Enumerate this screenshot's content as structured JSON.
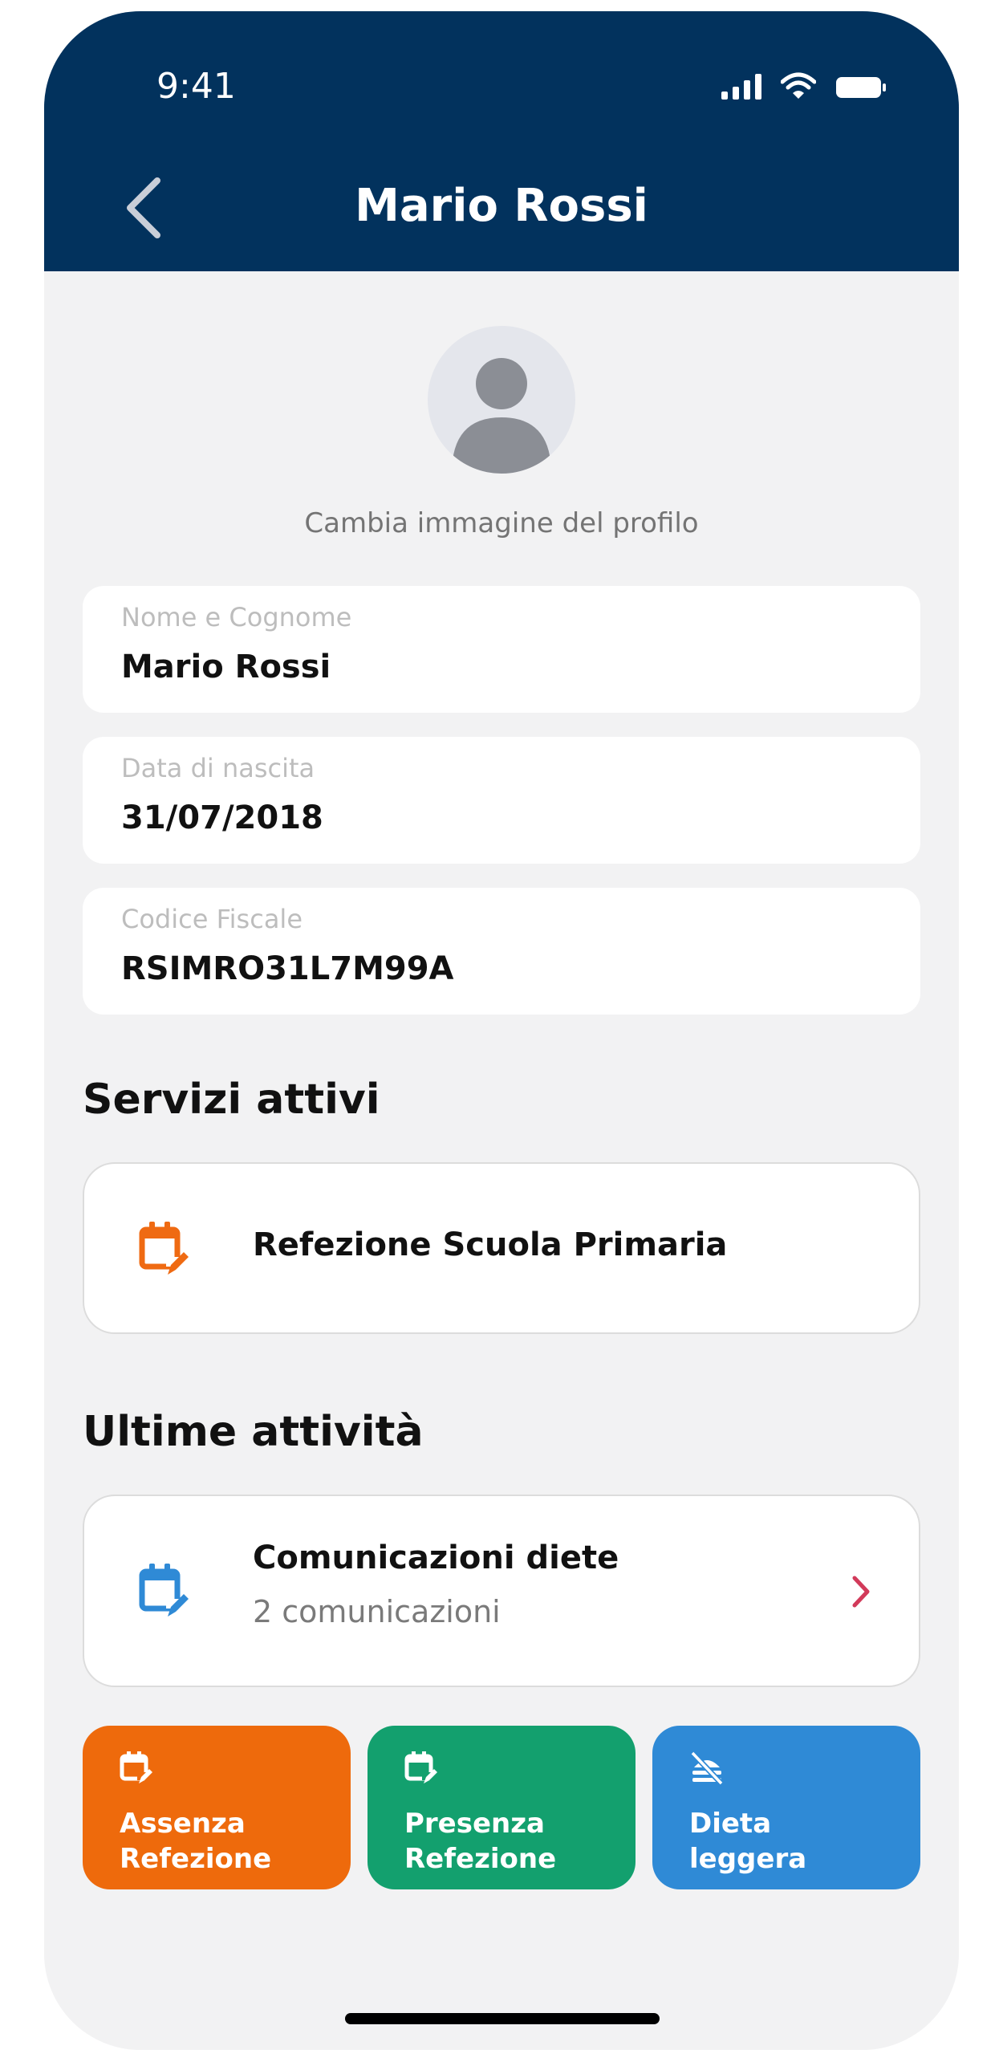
{
  "status": {
    "time": "9:41"
  },
  "header": {
    "title": "Mario Rossi"
  },
  "profile": {
    "change_photo_label": "Cambia immagine del profilo"
  },
  "fields": [
    {
      "label": "Nome e Cognome",
      "value": "Mario Rossi"
    },
    {
      "label": "Data di nascita",
      "value": "31/07/2018"
    },
    {
      "label": "Codice Fiscale",
      "value": "RSIMRO31L7M99A"
    }
  ],
  "services": {
    "title": "Servizi attivi",
    "items": [
      {
        "label": "Refezione Scuola Primaria",
        "icon": "calendar-edit-icon",
        "color": "#ef6a12"
      }
    ]
  },
  "activities": {
    "title": "Ultime attività",
    "items": [
      {
        "title": "Comunicazioni diete",
        "subtitle": "2 comunicazioni",
        "icon": "calendar-edit-icon",
        "color": "#2f8ad6"
      }
    ]
  },
  "actions": [
    {
      "label": "Assenza\nRefezione",
      "icon": "calendar-edit-icon",
      "color": "#ee6a0c"
    },
    {
      "label": "Presenza\nRefezione",
      "icon": "calendar-edit-icon",
      "color": "#13a06e"
    },
    {
      "label": "Dieta\nleggera",
      "icon": "no-food-icon",
      "color": "#2f8ad6"
    }
  ],
  "colors": {
    "header": "#02325d",
    "background": "#f2f2f3",
    "chevron": "#d23a5a"
  }
}
